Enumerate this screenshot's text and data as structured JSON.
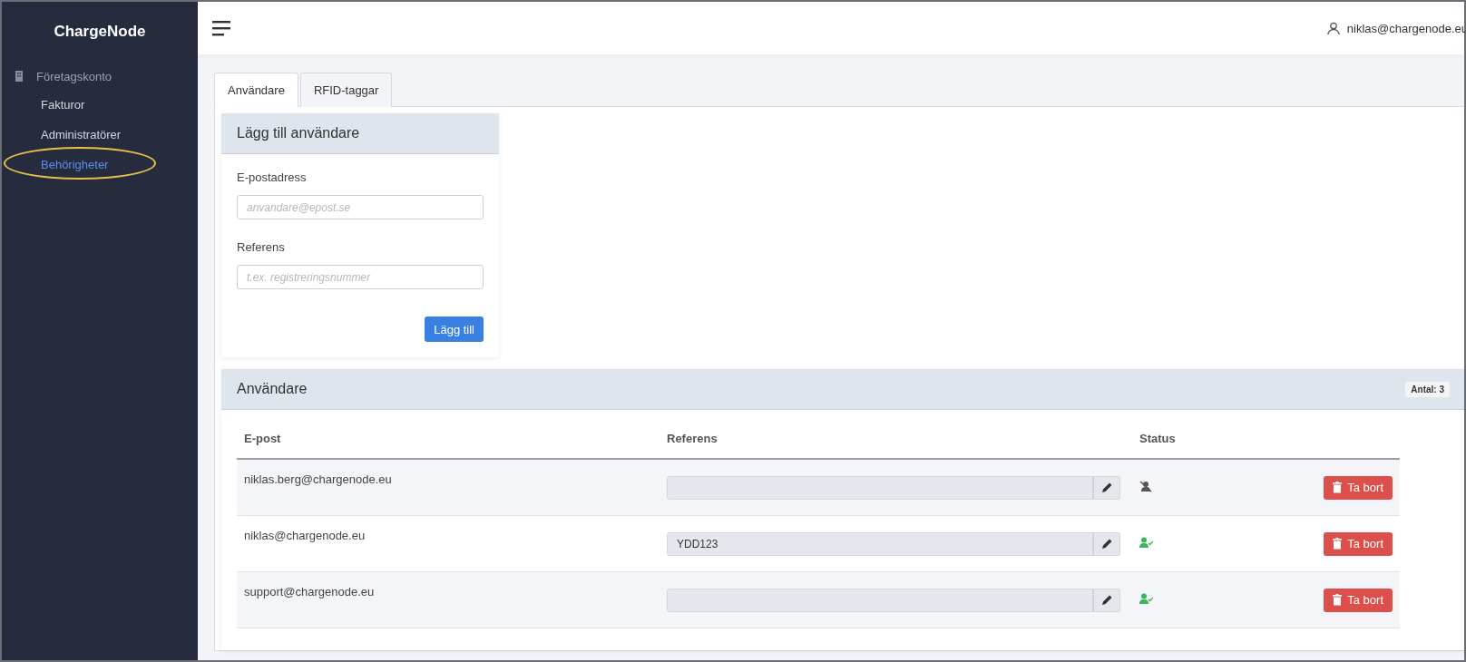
{
  "sidebar": {
    "logo": "ChargeNode",
    "section": {
      "label": "Företagskonto"
    },
    "items": [
      {
        "label": "Fakturor",
        "selected": false,
        "annotated": false
      },
      {
        "label": "Administratörer",
        "selected": false,
        "annotated": false
      },
      {
        "label": "Behörigheter",
        "selected": true,
        "annotated": true
      }
    ]
  },
  "topbar": {
    "user": "niklas@chargenode.eu"
  },
  "tabs": [
    {
      "label": "Användare",
      "selected": true
    },
    {
      "label": "RFID-taggar",
      "selected": false
    }
  ],
  "add_user": {
    "title": "Lägg till användare",
    "fields": [
      {
        "label": "E-postadress",
        "placeholder": "anvandare@epost.se"
      },
      {
        "label": "Referens",
        "placeholder": "t.ex. registreringsnummer"
      }
    ],
    "button": "Lägg till"
  },
  "users": {
    "title": "Användare",
    "count": "Antal: 3",
    "columns": [
      "E-post",
      "Referens",
      "Status"
    ],
    "rows": [
      {
        "email": "niklas.berg@chargenode.eu",
        "reference": "",
        "active": false,
        "button": "Ta bort"
      },
      {
        "email": "niklas@chargenode.eu",
        "reference": "YDD123",
        "active": true,
        "button": "Ta bort"
      },
      {
        "email": "support@chargenode.eu",
        "reference": "",
        "active": true,
        "button": "Ta bort"
      }
    ]
  }
}
